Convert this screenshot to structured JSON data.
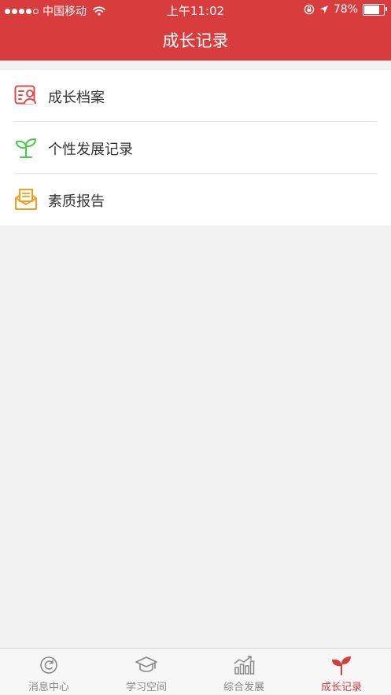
{
  "status_bar": {
    "carrier": "中国移动",
    "time": "上午11:02",
    "battery": "78%",
    "battery_level": 0.78
  },
  "nav": {
    "title": "成长记录"
  },
  "menu": {
    "items": [
      {
        "label": "成长档案",
        "icon": "profile-card-icon"
      },
      {
        "label": "个性发展记录",
        "icon": "sprout-icon"
      },
      {
        "label": "素质报告",
        "icon": "mail-report-icon"
      }
    ]
  },
  "tabbar": {
    "tabs": [
      {
        "label": "消息中心",
        "icon": "message-center-icon",
        "active": false
      },
      {
        "label": "学习空间",
        "icon": "graduation-cap-icon",
        "active": false
      },
      {
        "label": "综合发展",
        "icon": "bar-chart-icon",
        "active": false
      },
      {
        "label": "成长记录",
        "icon": "sprout-icon",
        "active": true
      }
    ]
  },
  "colors": {
    "accent": "#d93c3c",
    "icon_red": "#e0474c",
    "icon_green": "#4cc94c",
    "icon_orange": "#f2a01d",
    "tab_inactive": "#888888"
  }
}
